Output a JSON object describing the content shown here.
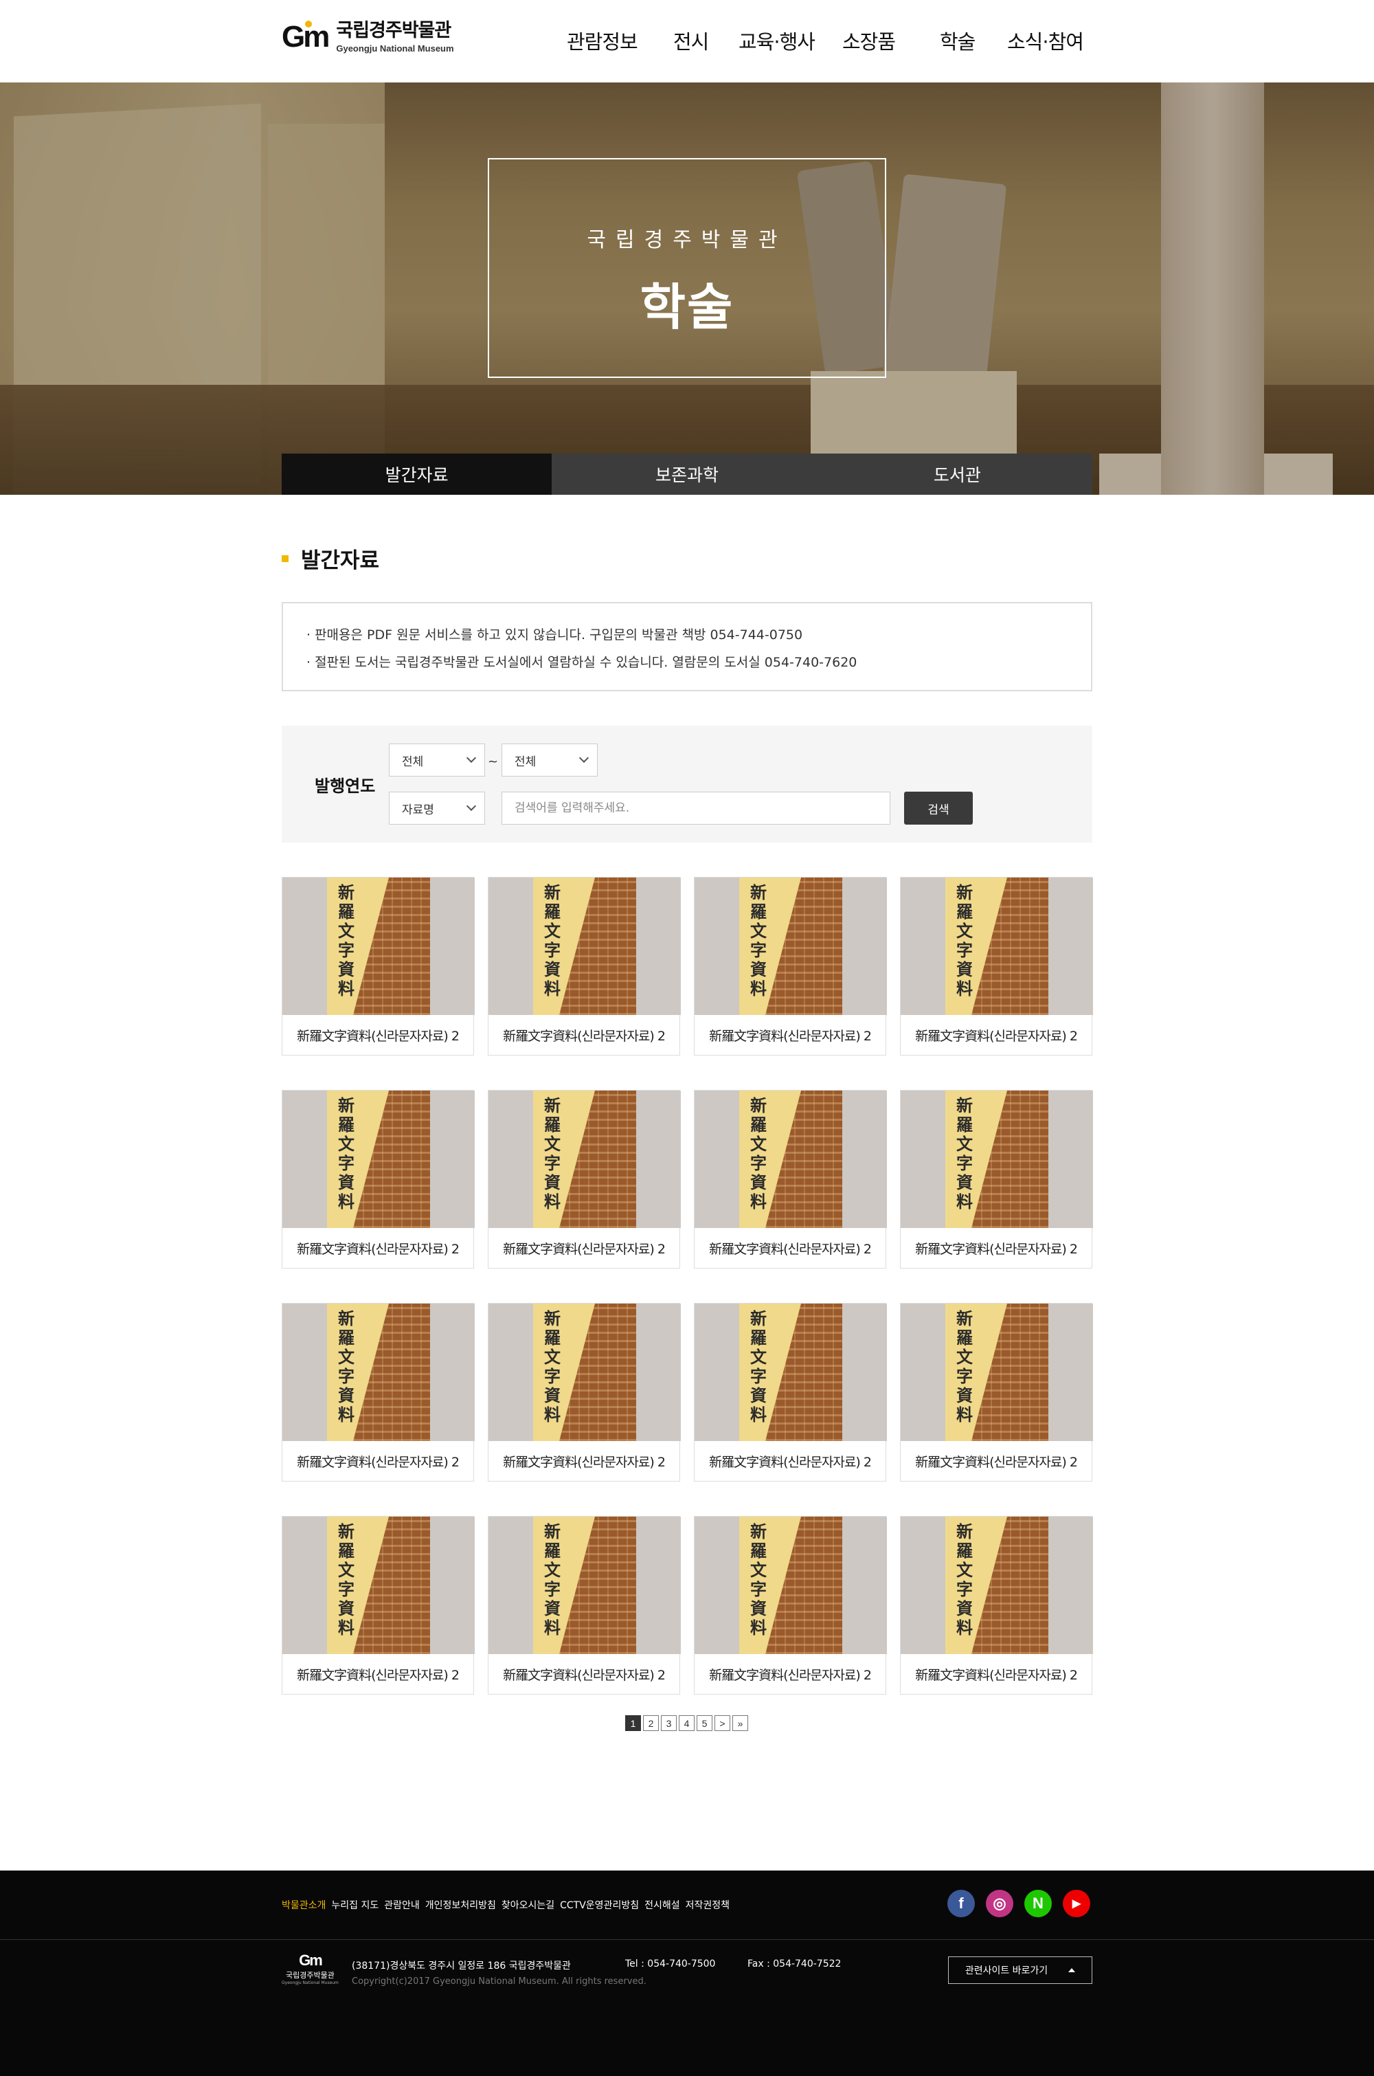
{
  "header": {
    "logo_mark": "Gm",
    "logo_ko": "국립경주박물관",
    "logo_en": "Gyeongju National Museum",
    "nav": [
      "관람정보",
      "전시",
      "교육·행사",
      "소장품",
      "학술",
      "소식·참여"
    ]
  },
  "hero": {
    "subtitle": "국립경주박물관",
    "title": "학술"
  },
  "subtabs": [
    "발간자료",
    "보존과학",
    "도서관"
  ],
  "section_title": "발간자료",
  "notice": [
    "· 판매용은 PDF 원문 서비스를 하고 있지 않습니다. 구입문의 박물관 책방 054-744-0750",
    "· 절판된 도서는 국립경주박물관 도서실에서 열람하실 수 있습니다. 열람문의 도서실 054-740-7620"
  ],
  "search": {
    "label": "발행연도",
    "year_from": "전체",
    "tilde": "~",
    "year_to": "전체",
    "field": "자료명",
    "placeholder": "검색어를 입력해주세요.",
    "button": "검색"
  },
  "books": [
    {
      "title": "新羅文字資料(신라문자자료) 2",
      "cover_title": "新羅文字資料"
    },
    {
      "title": "新羅文字資料(신라문자자료) 2",
      "cover_title": "新羅文字資料"
    },
    {
      "title": "新羅文字資料(신라문자자료) 2",
      "cover_title": "新羅文字資料"
    },
    {
      "title": "新羅文字資料(신라문자자료) 2",
      "cover_title": "新羅文字資料"
    },
    {
      "title": "新羅文字資料(신라문자자료) 2",
      "cover_title": "新羅文字資料"
    },
    {
      "title": "新羅文字資料(신라문자자료) 2",
      "cover_title": "新羅文字資料"
    },
    {
      "title": "新羅文字資料(신라문자자료) 2",
      "cover_title": "新羅文字資料"
    },
    {
      "title": "新羅文字資料(신라문자자료) 2",
      "cover_title": "新羅文字資料"
    },
    {
      "title": "新羅文字資料(신라문자자료) 2",
      "cover_title": "新羅文字資料"
    },
    {
      "title": "新羅文字資料(신라문자자료) 2",
      "cover_title": "新羅文字資料"
    },
    {
      "title": "新羅文字資料(신라문자자료) 2",
      "cover_title": "新羅文字資料"
    },
    {
      "title": "新羅文字資料(신라문자자료) 2",
      "cover_title": "新羅文字資料"
    },
    {
      "title": "新羅文字資料(신라문자자료) 2",
      "cover_title": "新羅文字資料"
    },
    {
      "title": "新羅文字資料(신라문자자료) 2",
      "cover_title": "新羅文字資料"
    },
    {
      "title": "新羅文字資料(신라문자자료) 2",
      "cover_title": "新羅文字資料"
    },
    {
      "title": "新羅文字資料(신라문자자료) 2",
      "cover_title": "新羅文字資料"
    }
  ],
  "pagination": {
    "pages": [
      "1",
      "2",
      "3",
      "4",
      "5"
    ],
    "current": "1",
    "next": ">",
    "last": "»"
  },
  "footer": {
    "links": [
      "박물관소개",
      "누리집 지도",
      "관람안내",
      "개인정보처리방침",
      "찾아오시는길",
      "CCTV운영관리방침",
      "전시해설",
      "저작권정책"
    ],
    "sns": [
      {
        "icon": "facebook-icon",
        "glyph": "f",
        "color": "#3b5998"
      },
      {
        "icon": "instagram-icon",
        "glyph": "◎",
        "color": "#c13584"
      },
      {
        "icon": "naver-icon",
        "glyph": "N",
        "color": "#1ec800"
      },
      {
        "icon": "youtube-icon",
        "glyph": "▶",
        "color": "#e00"
      }
    ],
    "logo_mark": "Gm",
    "logo_ko": "국립경주박물관",
    "logo_en": "Gyeongju National Museum",
    "address": "(38171)경상북도 경주시 일정로 186 국립경주박물관",
    "tel": "Tel : 054-740-7500",
    "fax": "Fax : 054-740-7522",
    "copyright": "Copyright(c)2017 Gyeongju National Museum. All rights reserved.",
    "related_sites": "관련사이트 바로가기"
  },
  "colors": {
    "accent": "#f2b705",
    "dark_tab": "#111111",
    "tab": "#3c3c3c"
  }
}
